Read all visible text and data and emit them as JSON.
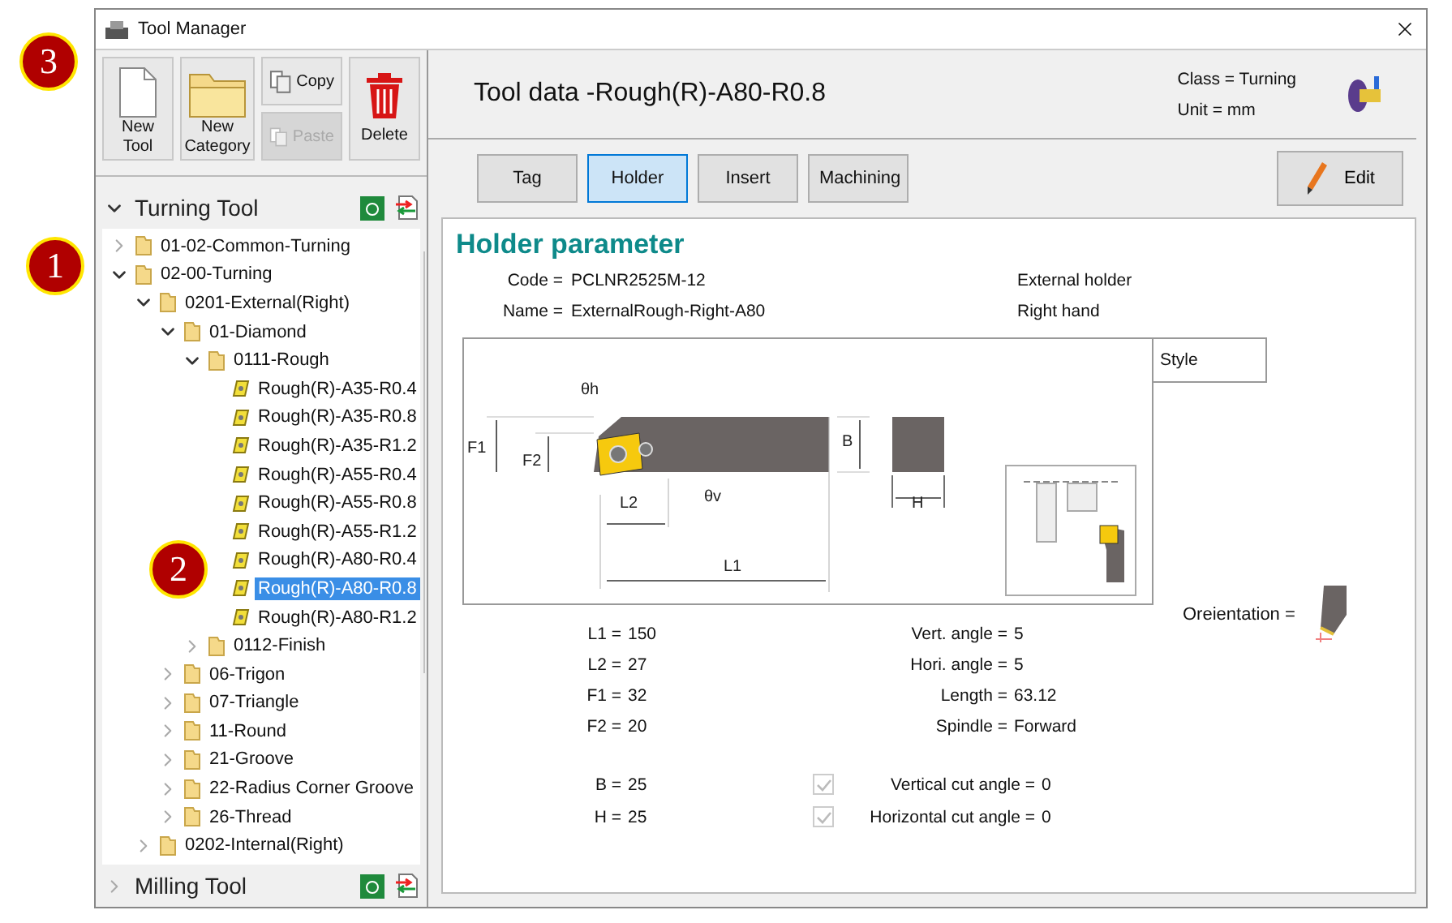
{
  "window": {
    "title": "Tool Manager"
  },
  "callouts": [
    {
      "label": "3"
    },
    {
      "label": "1"
    },
    {
      "label": "2"
    }
  ],
  "toolbar": [
    {
      "kind": "new-tool",
      "label": "New Tool",
      "disabled": false
    },
    {
      "kind": "new-category",
      "label": "New Category",
      "disabled": false
    },
    {
      "kind": "copy",
      "label": "Copy",
      "disabled": false
    },
    {
      "kind": "paste",
      "label": "Paste",
      "disabled": true
    },
    {
      "kind": "delete",
      "label": "Delete",
      "disabled": false
    }
  ],
  "sections": [
    {
      "label": "Turning Tool",
      "expanded": true
    },
    {
      "label": "Milling Tool",
      "expanded": false
    }
  ],
  "tree": [
    {
      "kind": "folder",
      "label": "01-02-Common-Turning",
      "expanded": false,
      "selected": false
    },
    {
      "kind": "folder",
      "label": "02-00-Turning",
      "expanded": true,
      "selected": false,
      "children": [
        {
          "kind": "folder",
          "label": "0201-External(Right)",
          "expanded": true,
          "selected": false,
          "children": [
            {
              "kind": "folder",
              "label": "01-Diamond",
              "expanded": true,
              "selected": false,
              "children": [
                {
                  "kind": "folder",
                  "label": "0111-Rough",
                  "expanded": true,
                  "selected": false,
                  "children": [
                    {
                      "kind": "tool",
                      "label": "Rough(R)-A35-R0.4",
                      "selected": false
                    },
                    {
                      "kind": "tool",
                      "label": "Rough(R)-A35-R0.8",
                      "selected": false
                    },
                    {
                      "kind": "tool",
                      "label": "Rough(R)-A35-R1.2",
                      "selected": false
                    },
                    {
                      "kind": "tool",
                      "label": "Rough(R)-A55-R0.4",
                      "selected": false
                    },
                    {
                      "kind": "tool",
                      "label": "Rough(R)-A55-R0.8",
                      "selected": false
                    },
                    {
                      "kind": "tool",
                      "label": "Rough(R)-A55-R1.2",
                      "selected": false
                    },
                    {
                      "kind": "tool",
                      "label": "Rough(R)-A80-R0.4",
                      "selected": false
                    },
                    {
                      "kind": "tool",
                      "label": "Rough(R)-A80-R0.8",
                      "selected": true
                    },
                    {
                      "kind": "tool",
                      "label": "Rough(R)-A80-R1.2",
                      "selected": false
                    }
                  ]
                },
                {
                  "kind": "folder",
                  "label": "0112-Finish",
                  "expanded": false,
                  "selected": false
                }
              ]
            },
            {
              "kind": "folder",
              "label": "06-Trigon",
              "expanded": false,
              "selected": false
            },
            {
              "kind": "folder",
              "label": "07-Triangle",
              "expanded": false,
              "selected": false
            },
            {
              "kind": "folder",
              "label": "11-Round",
              "expanded": false,
              "selected": false
            },
            {
              "kind": "folder",
              "label": "21-Groove",
              "expanded": false,
              "selected": false
            },
            {
              "kind": "folder",
              "label": "22-Radius Corner Groove",
              "expanded": false,
              "selected": false
            },
            {
              "kind": "folder",
              "label": "26-Thread",
              "expanded": false,
              "selected": false
            }
          ]
        },
        {
          "kind": "folder",
          "label": "0202-Internal(Right)",
          "expanded": false,
          "selected": false
        }
      ]
    }
  ],
  "header": {
    "title": "Tool data -Rough(R)-A80-R0.8",
    "class": "Class = Turning",
    "unit": "Unit = mm"
  },
  "tabs": [
    {
      "label": "Tag",
      "selected": false
    },
    {
      "label": "Holder",
      "selected": true
    },
    {
      "label": "Insert",
      "selected": false
    },
    {
      "label": "Machining",
      "selected": false
    }
  ],
  "edit_button": "Edit",
  "holder": {
    "heading": "Holder parameter",
    "info": [
      {
        "label": "Code =",
        "value": "PCLNR2525M-12",
        "note": "External holder"
      },
      {
        "label": "Name =",
        "value": "ExternalRough-Right-A80",
        "note": "Right hand"
      }
    ],
    "style_label": "Style",
    "diagram_labels": [
      "θh",
      "F1",
      "F2",
      "B",
      "θv",
      "L2",
      "H",
      "L1"
    ],
    "params": [
      {
        "label": "L1 =",
        "value": "150",
        "label2": "Vert. angle =",
        "value2": "5"
      },
      {
        "label": "L2 =",
        "value": "27",
        "label2": "Hori. angle =",
        "value2": "5"
      },
      {
        "label": "F1 =",
        "value": "32",
        "label2": "Length =",
        "value2": "63.12"
      },
      {
        "label": "F2 =",
        "value": "20",
        "label2": "Spindle =",
        "value2": "Forward"
      }
    ],
    "checks": [
      {
        "label": "B =",
        "value": "25",
        "check_label": "Vertical cut angle =",
        "check_value": "0",
        "checked": true,
        "disabled": true
      },
      {
        "label": "H =",
        "value": "25",
        "check_label": "Horizontal cut angle =",
        "check_value": "0",
        "checked": true,
        "disabled": true
      }
    ],
    "orientation_label": "Oreientation ="
  }
}
